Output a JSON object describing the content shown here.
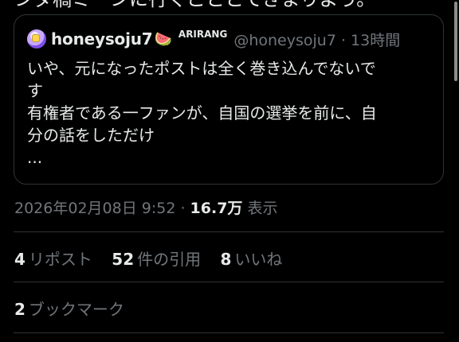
{
  "top_text": "ンダ稿ミ一ンに行くこととてきまりよう。",
  "quote": {
    "display_name": "honeysoju7",
    "emoji": "🍉",
    "badge": "ARIRANG",
    "handle_time": "@honeysoju7 · 13時間",
    "lines": [
      "いや、元になったポストは全く巻き込んでないで",
      "す",
      "有権者である一ファンが、自国の選挙を前に、自",
      "分の話をしただけ",
      "..."
    ]
  },
  "meta": {
    "datetime": "2026年02月08日 9:52",
    "separator": " · ",
    "views_count": "16.7万",
    "views_label": " 表示"
  },
  "stats": [
    {
      "count": "4",
      "label": "リポスト"
    },
    {
      "count": "52",
      "label": "件の引用"
    },
    {
      "count": "8",
      "label": "いいね"
    }
  ],
  "bookmarks": {
    "count": "2",
    "label": "ブックマーク"
  },
  "colors": {
    "background": "#000000",
    "text": "#e7e9ea",
    "muted": "#71767b",
    "border": "#2f3336"
  },
  "icons": {
    "avatar": "user-avatar",
    "name_emoji": "watermelon-icon"
  }
}
